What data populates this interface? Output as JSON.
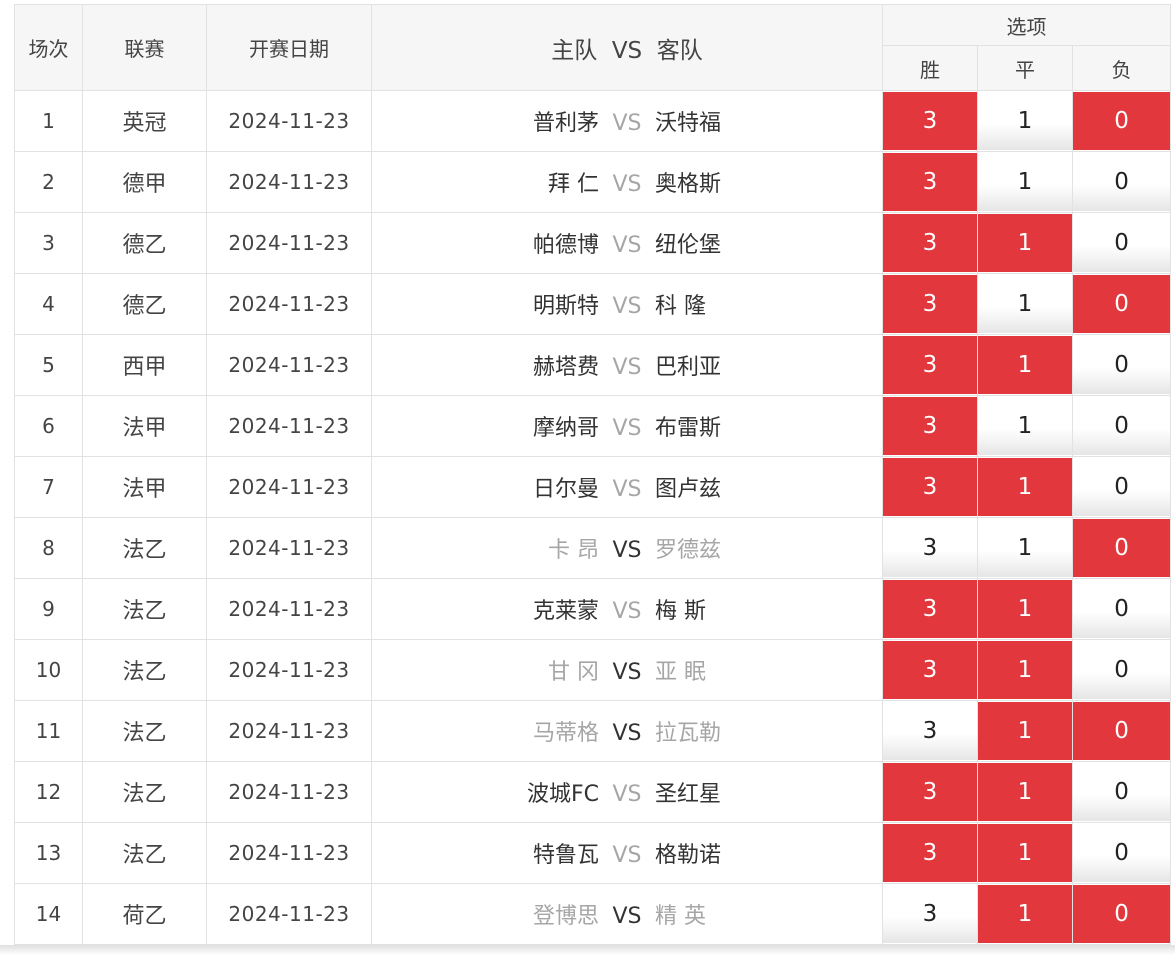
{
  "header": {
    "num": "场次",
    "league": "联赛",
    "date": "开赛日期",
    "home": "主队",
    "vs": "VS",
    "away": "客队",
    "options": "选项",
    "win": "胜",
    "draw": "平",
    "lose": "负"
  },
  "colors": {
    "selected": "#e2373c",
    "unselected": "#ffffff",
    "text_light": "#a6a6a6"
  },
  "rows": [
    {
      "num": "1",
      "league": "英冠",
      "date": "2024-11-23",
      "home": "普利茅",
      "away": "沃特福",
      "emphasis": "home",
      "win": {
        "v": "3",
        "sel": true
      },
      "draw": {
        "v": "1",
        "sel": false
      },
      "lose": {
        "v": "0",
        "sel": true
      }
    },
    {
      "num": "2",
      "league": "德甲",
      "date": "2024-11-23",
      "home": "拜 仁",
      "away": "奥格斯",
      "emphasis": "home",
      "win": {
        "v": "3",
        "sel": true
      },
      "draw": {
        "v": "1",
        "sel": false
      },
      "lose": {
        "v": "0",
        "sel": false
      }
    },
    {
      "num": "3",
      "league": "德乙",
      "date": "2024-11-23",
      "home": "帕德博",
      "away": "纽伦堡",
      "emphasis": "home",
      "win": {
        "v": "3",
        "sel": true
      },
      "draw": {
        "v": "1",
        "sel": true
      },
      "lose": {
        "v": "0",
        "sel": false
      }
    },
    {
      "num": "4",
      "league": "德乙",
      "date": "2024-11-23",
      "home": "明斯特",
      "away": "科 隆",
      "emphasis": "home",
      "win": {
        "v": "3",
        "sel": true
      },
      "draw": {
        "v": "1",
        "sel": false
      },
      "lose": {
        "v": "0",
        "sel": true
      }
    },
    {
      "num": "5",
      "league": "西甲",
      "date": "2024-11-23",
      "home": "赫塔费",
      "away": "巴利亚",
      "emphasis": "home",
      "win": {
        "v": "3",
        "sel": true
      },
      "draw": {
        "v": "1",
        "sel": true
      },
      "lose": {
        "v": "0",
        "sel": false
      }
    },
    {
      "num": "6",
      "league": "法甲",
      "date": "2024-11-23",
      "home": "摩纳哥",
      "away": "布雷斯",
      "emphasis": "home",
      "win": {
        "v": "3",
        "sel": true
      },
      "draw": {
        "v": "1",
        "sel": false
      },
      "lose": {
        "v": "0",
        "sel": false
      }
    },
    {
      "num": "7",
      "league": "法甲",
      "date": "2024-11-23",
      "home": "日尔曼",
      "away": "图卢兹",
      "emphasis": "home",
      "win": {
        "v": "3",
        "sel": true
      },
      "draw": {
        "v": "1",
        "sel": true
      },
      "lose": {
        "v": "0",
        "sel": false
      }
    },
    {
      "num": "8",
      "league": "法乙",
      "date": "2024-11-23",
      "home": "卡 昂",
      "away": "罗德兹",
      "emphasis": "vs",
      "win": {
        "v": "3",
        "sel": false
      },
      "draw": {
        "v": "1",
        "sel": false
      },
      "lose": {
        "v": "0",
        "sel": true
      }
    },
    {
      "num": "9",
      "league": "法乙",
      "date": "2024-11-23",
      "home": "克莱蒙",
      "away": "梅 斯",
      "emphasis": "home",
      "win": {
        "v": "3",
        "sel": true
      },
      "draw": {
        "v": "1",
        "sel": true
      },
      "lose": {
        "v": "0",
        "sel": false
      }
    },
    {
      "num": "10",
      "league": "法乙",
      "date": "2024-11-23",
      "home": "甘 冈",
      "away": "亚 眠",
      "emphasis": "vs",
      "win": {
        "v": "3",
        "sel": true
      },
      "draw": {
        "v": "1",
        "sel": true
      },
      "lose": {
        "v": "0",
        "sel": false
      }
    },
    {
      "num": "11",
      "league": "法乙",
      "date": "2024-11-23",
      "home": "马蒂格",
      "away": "拉瓦勒",
      "emphasis": "vs",
      "win": {
        "v": "3",
        "sel": false
      },
      "draw": {
        "v": "1",
        "sel": true
      },
      "lose": {
        "v": "0",
        "sel": true
      }
    },
    {
      "num": "12",
      "league": "法乙",
      "date": "2024-11-23",
      "home": "波城FC",
      "away": "圣红星",
      "emphasis": "home",
      "win": {
        "v": "3",
        "sel": true
      },
      "draw": {
        "v": "1",
        "sel": true
      },
      "lose": {
        "v": "0",
        "sel": false
      }
    },
    {
      "num": "13",
      "league": "法乙",
      "date": "2024-11-23",
      "home": "特鲁瓦",
      "away": "格勒诺",
      "emphasis": "home",
      "win": {
        "v": "3",
        "sel": true
      },
      "draw": {
        "v": "1",
        "sel": true
      },
      "lose": {
        "v": "0",
        "sel": false
      }
    },
    {
      "num": "14",
      "league": "荷乙",
      "date": "2024-11-23",
      "home": "登博思",
      "away": "精 英",
      "emphasis": "vs",
      "win": {
        "v": "3",
        "sel": false
      },
      "draw": {
        "v": "1",
        "sel": true
      },
      "lose": {
        "v": "0",
        "sel": true
      }
    }
  ]
}
